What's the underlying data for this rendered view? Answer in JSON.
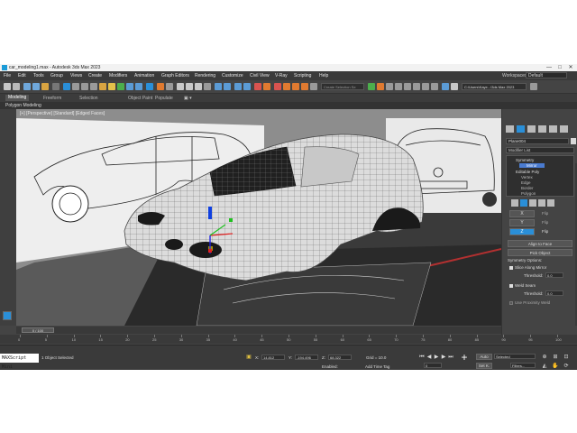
{
  "window": {
    "title": "car_modeling1.max - Autodesk 3ds Max 2023",
    "minimize": "—",
    "maximize": "□",
    "close": "✕"
  },
  "menu": {
    "items": [
      "File",
      "Edit",
      "Tools",
      "Group",
      "Views",
      "Create",
      "Modifiers",
      "Animation",
      "Graph Editors",
      "Rendering",
      "Customize",
      "Civil View",
      "V-Ray",
      "Scripting",
      "Help"
    ],
    "workspaces_label": "Workspaces:",
    "workspaces_value": "Default"
  },
  "toolbar": {
    "view_dropdown": "View",
    "selection_set_placeholder": "Create Selection Se",
    "project_path": "C:\\Users\\Kaye...\\3ds Max 2023"
  },
  "ribbon": {
    "tabs": [
      "Modeling",
      "Freeform",
      "Selection",
      "Object Paint",
      "Populate"
    ],
    "active_panel": "Polygon Modeling"
  },
  "viewport": {
    "label": "[+] [Perspective] [Standard] [Edged Faces]"
  },
  "command_panel": {
    "object_name": "Plane004",
    "object_color": "#d8d8d8",
    "modifier_list": "Modifier List",
    "stack": {
      "symmetry": "Symmetry",
      "mirror": "Mirror",
      "editable_poly": "Editable Poly",
      "vertex": "Vertex",
      "edge": "Edge",
      "border": "Border",
      "polygon": "Polygon"
    },
    "axes": [
      "X",
      "Y",
      "Z"
    ],
    "flip_label": "Flip",
    "align_to_face": "Align to Face",
    "pick_object": "Pick Object",
    "symmetry_options": "Symmetry Options:",
    "slice_along_mirror": "Slice Along Mirror",
    "threshold_label": "Threshold:",
    "threshold_1": "0.0",
    "weld_seam": "Weld Seam",
    "threshold_2": "0.0",
    "use_proximity_weld": "Use Proximity Weld"
  },
  "timeline": {
    "slider_label": "0 / 100",
    "ticks": [
      "0",
      "5",
      "10",
      "15",
      "20",
      "25",
      "30",
      "35",
      "40",
      "45",
      "50",
      "55",
      "60",
      "65",
      "70",
      "75",
      "80",
      "85",
      "90",
      "95",
      "100"
    ]
  },
  "status": {
    "maxscript": "MAXScript Mini",
    "selected": "1 Object Selected",
    "x_label": "X:",
    "x_value": "14.812",
    "y_label": "Y:",
    "y_value": "-194.496",
    "z_label": "Z:",
    "z_value": "68.322",
    "grid": "Grid = 10.0",
    "enabled_label": "Enabled:",
    "add_time_tag": "Add Time Tag",
    "frame_value": "0",
    "auto": "Auto",
    "set_k": "Set K.",
    "selected_dropdown": "Selected",
    "filters": "Filters..."
  }
}
